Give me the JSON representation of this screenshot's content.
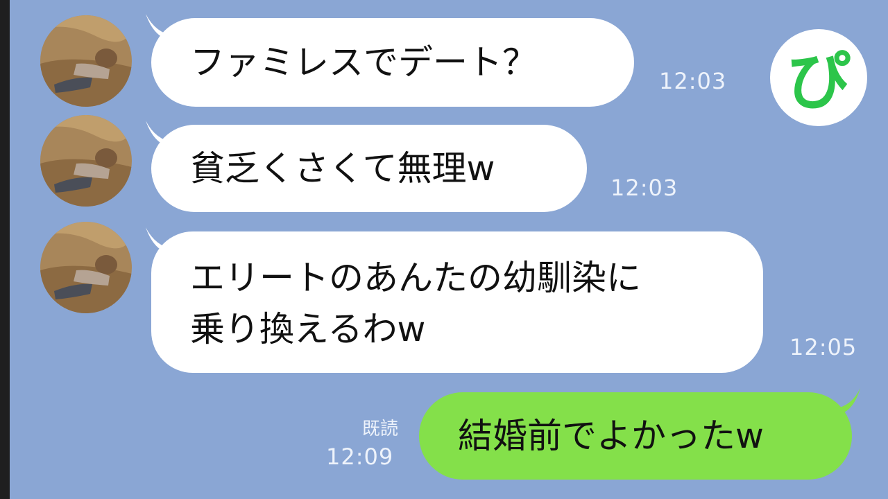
{
  "messages": [
    {
      "text": "ファミレスでデート？",
      "time": "12:03"
    },
    {
      "text": "貧乏くさくて無理w",
      "time": "12:03"
    },
    {
      "line1": "エリートのあんたの幼馴染に",
      "line2": "乗り換えるわw",
      "time": "12:05"
    }
  ],
  "reply": {
    "text": "結婚前でよかったw",
    "read": "既読",
    "time": "12:09"
  },
  "logo": {
    "text": "ぴ",
    "color": "#2cc54a"
  },
  "colors": {
    "background": "#8aa6d4",
    "incoming": "#ffffff",
    "outgoing": "#84e04a"
  },
  "avatar_icon": "person-lying-in-grass-photo"
}
